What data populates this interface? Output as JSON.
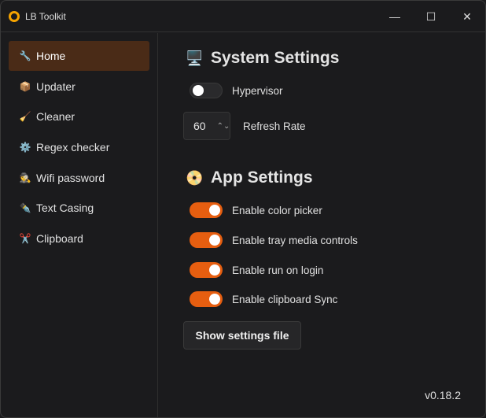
{
  "window": {
    "title": "LB Toolkit",
    "minimize": "—",
    "maximize": "☐",
    "close": "✕"
  },
  "sidebar": {
    "items": [
      {
        "label": "Home",
        "icon": "🔧",
        "active": true
      },
      {
        "label": "Updater",
        "icon": "📦"
      },
      {
        "label": "Cleaner",
        "icon": "🧹"
      },
      {
        "label": "Regex checker",
        "icon": "⚙️"
      },
      {
        "label": "Wifi password",
        "icon": "🕵️"
      },
      {
        "label": "Text Casing",
        "icon": "✒️"
      },
      {
        "label": "Clipboard",
        "icon": "✂️"
      }
    ]
  },
  "system": {
    "title": "System Settings",
    "icon": "🖥️",
    "hypervisor": {
      "label": "Hypervisor",
      "on": false
    },
    "refresh": {
      "label": "Refresh Rate",
      "value": "60",
      "spin": "⌃⌄"
    }
  },
  "app": {
    "title": "App Settings",
    "icon": "📀",
    "toggles": [
      {
        "label": "Enable color picker",
        "on": true
      },
      {
        "label": "Enable tray media controls",
        "on": true
      },
      {
        "label": "Enable run on login",
        "on": true
      },
      {
        "label": "Enable clipboard Sync",
        "on": true
      }
    ]
  },
  "show_settings": "Show settings file",
  "version": "v0.18.2",
  "colors": {
    "accent": "#e65e10",
    "active_nav": "#4a2b17"
  }
}
